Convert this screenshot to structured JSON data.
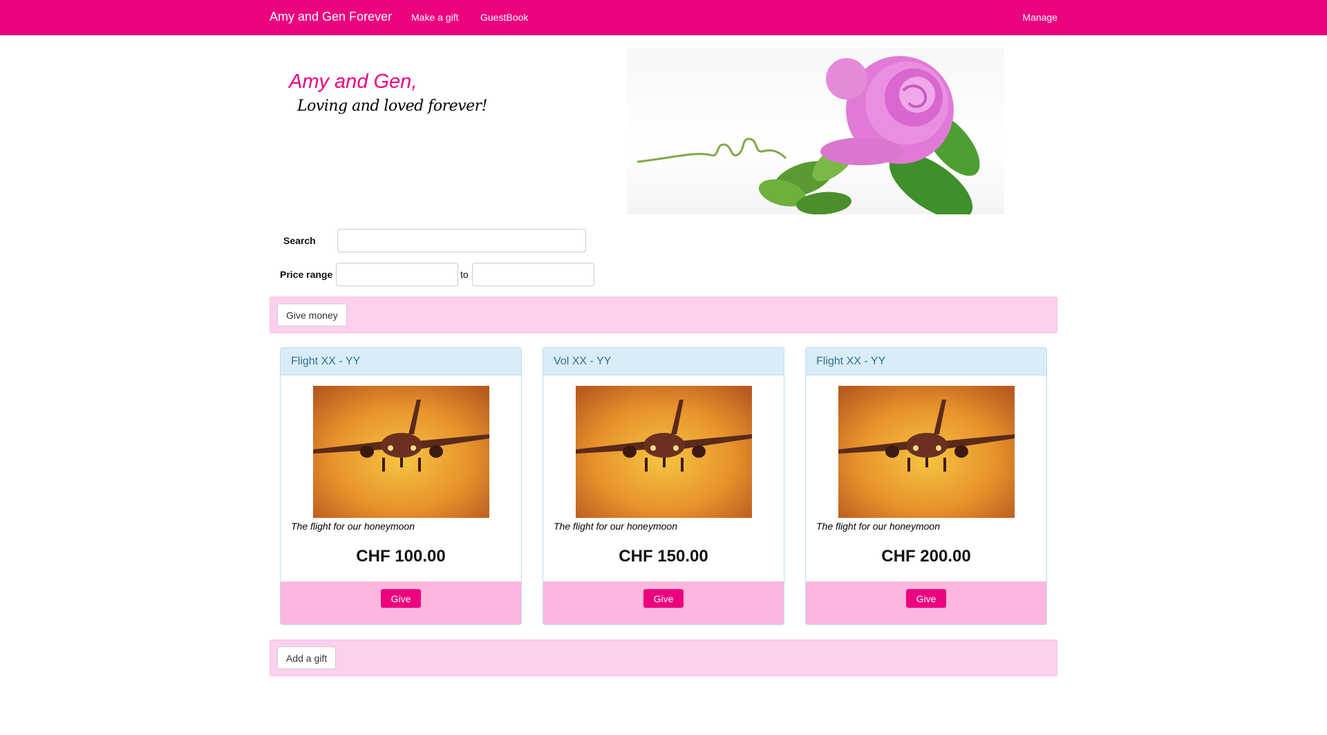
{
  "nav": {
    "brand": "Amy and Gen Forever",
    "make_gift": "Make a gift",
    "guestbook": "GuestBook",
    "manage": "Manage"
  },
  "header": {
    "title": "Amy and Gen,",
    "subtitle": "Loving and loved forever!"
  },
  "search": {
    "search_label": "Search",
    "search_value": "",
    "price_label": "Price range",
    "to_label": "to",
    "price_min": "",
    "price_max": ""
  },
  "actions": {
    "give_money": "Give money",
    "add_gift": "Add a gift"
  },
  "gifts": [
    {
      "title": "Flight XX - YY",
      "description": "The flight for our honeymoon",
      "price": "CHF 100.00",
      "button": "Give"
    },
    {
      "title": "Vol XX - YY",
      "description": "The flight for our honeymoon",
      "price": "CHF 150.00",
      "button": "Give"
    },
    {
      "title": "Flight XX - YY",
      "description": "The flight for our honeymoon",
      "price": "CHF 200.00",
      "button": "Give"
    }
  ],
  "colors": {
    "brand": "#ec017f",
    "panel_pink": "#fdd0ee",
    "card_footer": "#fdb6de",
    "card_header": "#d9edf7",
    "card_title": "#31708f"
  },
  "images": {
    "banner": "pink-rose-photo",
    "gift": "airplane-sunset-photo"
  }
}
